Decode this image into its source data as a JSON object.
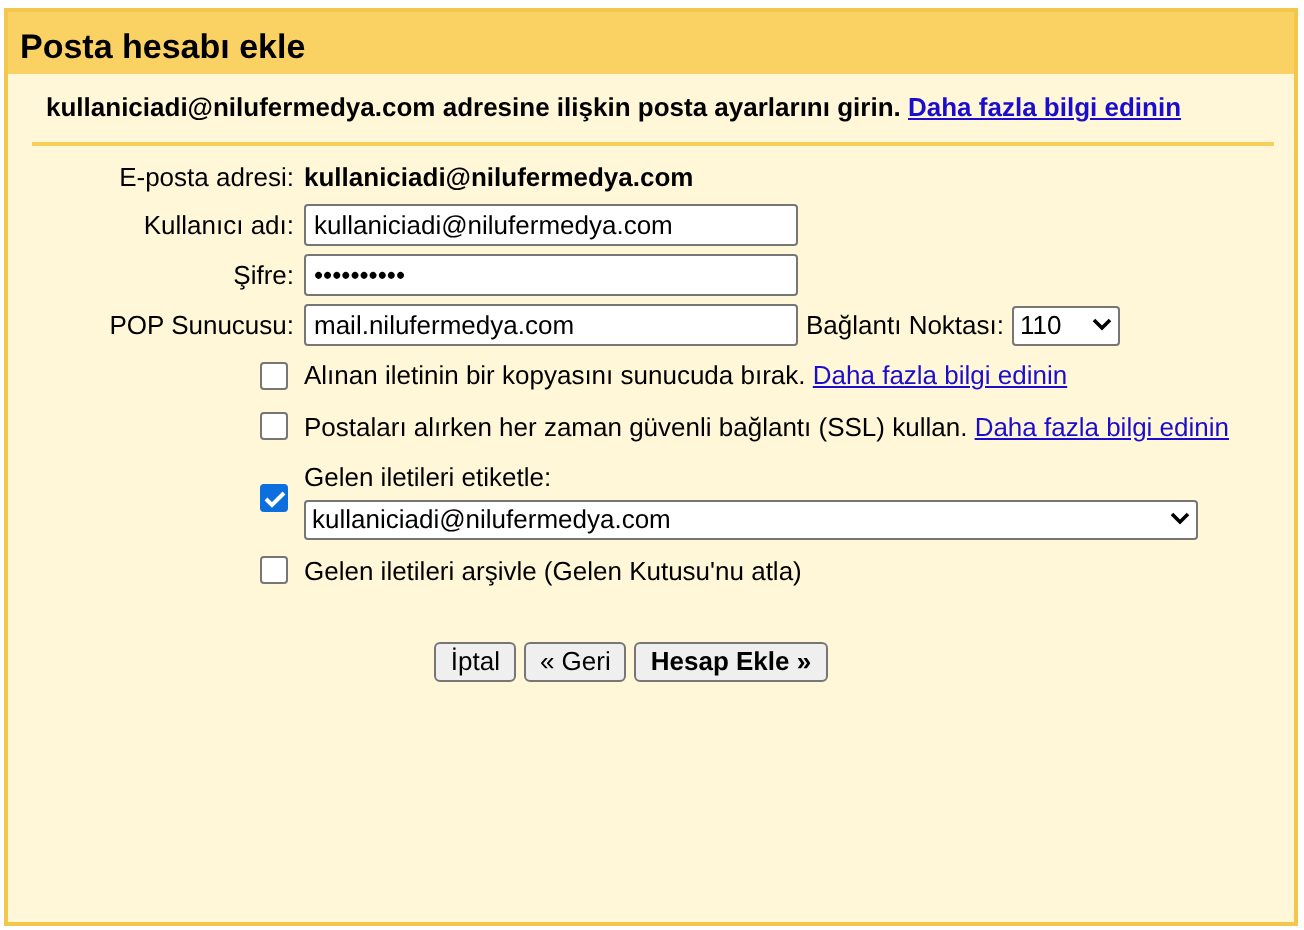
{
  "dialog": {
    "title": "Posta hesabı ekle"
  },
  "intro": {
    "text": "kullaniciadi@nilufermedya.com adresine ilişkin posta ayarlarını girin.",
    "link": "Daha fazla bilgi edinin"
  },
  "fields": [
    {
      "label": "E-posta adresi:",
      "kind": "static",
      "value": "kullaniciadi@nilufermedya.com"
    },
    {
      "label": "Kullanıcı adı:",
      "kind": "text",
      "value": "kullaniciadi@nilufermedya.com"
    },
    {
      "label": "Şifre:",
      "kind": "text",
      "value": "••••••••••"
    },
    {
      "label": "POP Sunucusu:",
      "kind": "server",
      "value": "mail.nilufermedya.com",
      "port_label": "Bağlantı Noktası:",
      "port": "110"
    }
  ],
  "options": [
    {
      "label": "Alınan iletinin bir kopyasını sunucuda bırak.",
      "checked": false,
      "link": "Daha fazla bilgi edinin"
    },
    {
      "label": "Postaları alırken her zaman güvenli bağlantı (SSL) kullan.",
      "checked": false,
      "link": "Daha fazla bilgi edinin"
    },
    {
      "label": "Gelen iletileri etiketle:",
      "checked": true,
      "select": "kullaniciadi@nilufermedya.com"
    },
    {
      "label": "Gelen iletileri arşivle (Gelen Kutusu'nu atla)",
      "checked": false
    }
  ],
  "buttons": [
    {
      "label": "İptal",
      "primary": false
    },
    {
      "label": "« Geri",
      "primary": false
    },
    {
      "label": "Hesap Ekle »",
      "primary": true
    }
  ]
}
